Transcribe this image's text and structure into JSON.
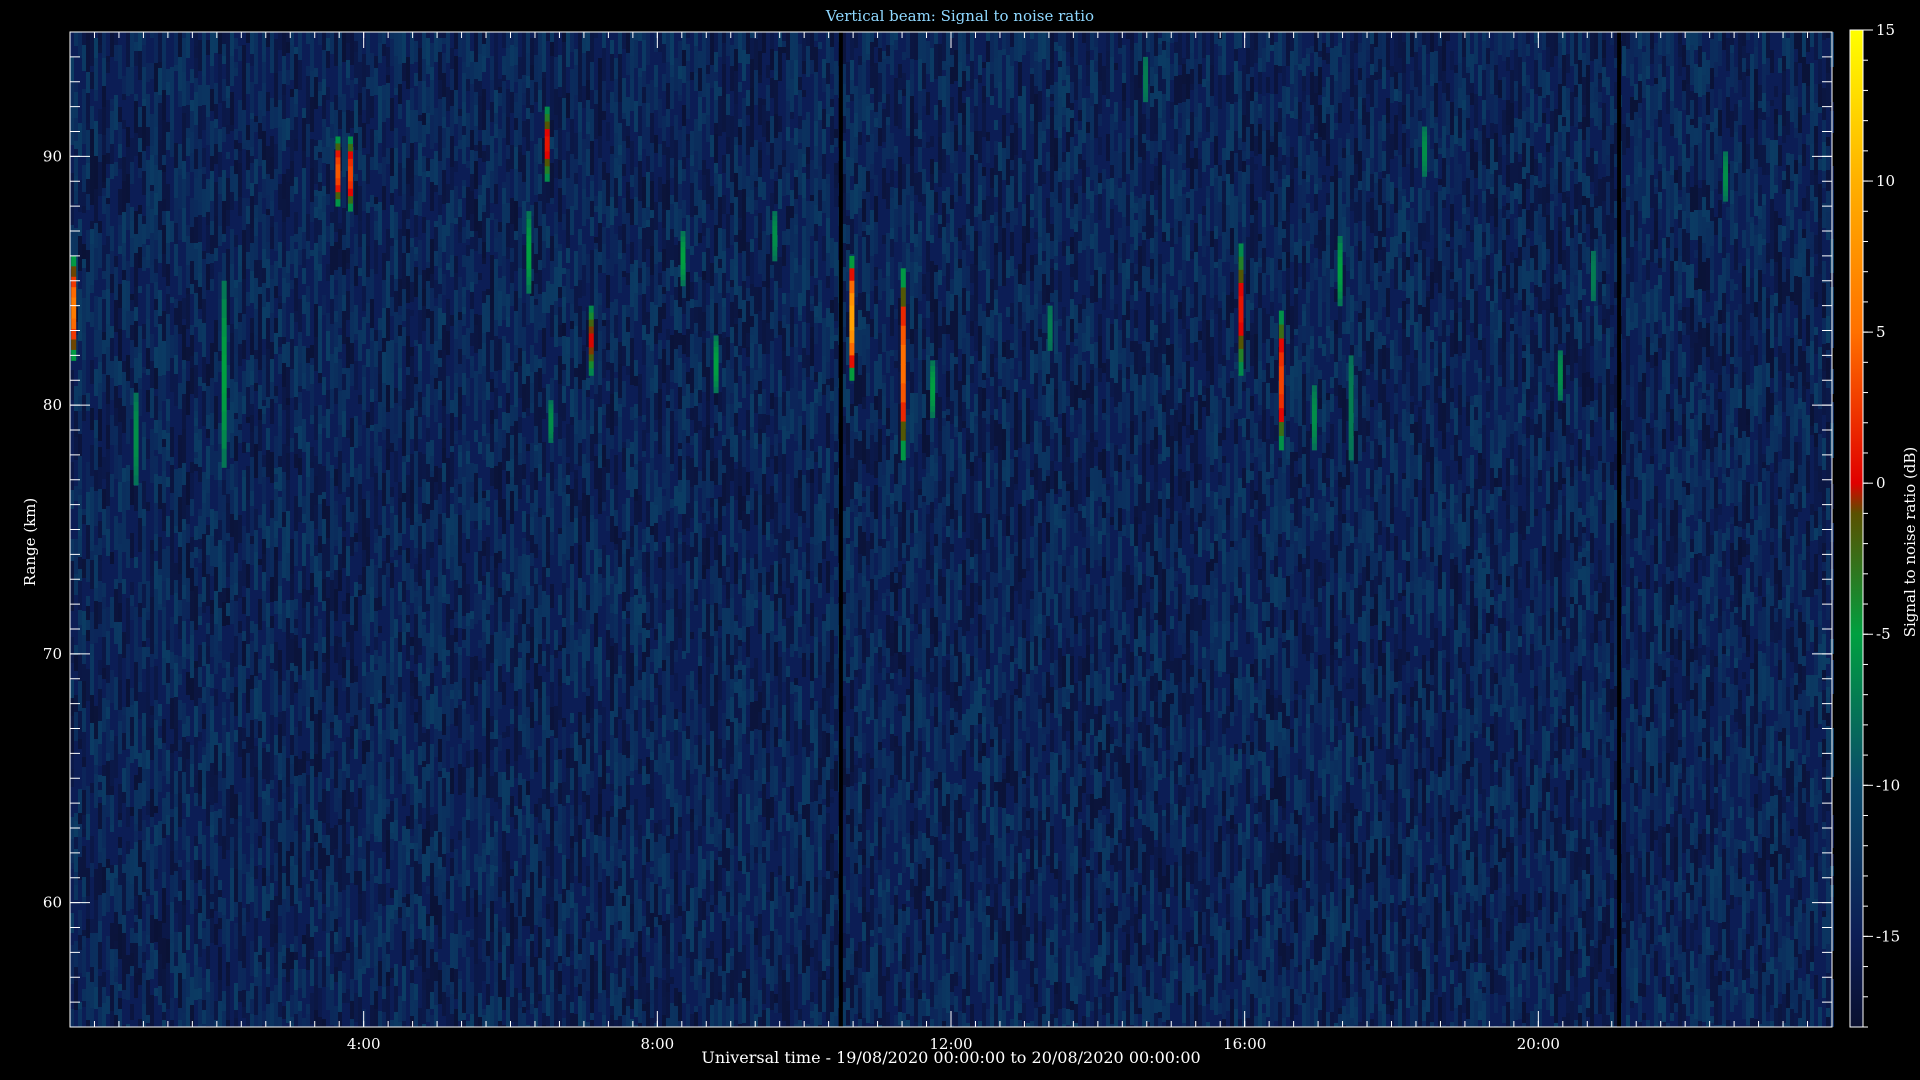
{
  "chart_data": {
    "type": "heatmap",
    "title": "Vertical beam: Signal to noise ratio",
    "xlabel": "Universal time - 19/08/2020 00:00:00 to 20/08/2020 00:00:00",
    "ylabel": "Range (km)",
    "colorbar_label": "Signal to noise ratio (dB)",
    "xlim_hours": [
      0,
      24
    ],
    "ylim_km": [
      55,
      95
    ],
    "x_ticks": [
      {
        "hour": 4,
        "label": "4:00"
      },
      {
        "hour": 8,
        "label": "8:00"
      },
      {
        "hour": 12,
        "label": "12:00"
      },
      {
        "hour": 16,
        "label": "16:00"
      },
      {
        "hour": 20,
        "label": "20:00"
      }
    ],
    "y_ticks": [
      {
        "km": 60,
        "label": "60"
      },
      {
        "km": 70,
        "label": "70"
      },
      {
        "km": 80,
        "label": "80"
      },
      {
        "km": 90,
        "label": "90"
      }
    ],
    "colorbar_range_db": [
      -18,
      15
    ],
    "colorbar_ticks": [
      {
        "db": 15,
        "label": "15"
      },
      {
        "db": 10,
        "label": "10"
      },
      {
        "db": 5,
        "label": "5"
      },
      {
        "db": 0,
        "label": "0"
      },
      {
        "db": -5,
        "label": "-5"
      },
      {
        "db": -10,
        "label": "-10"
      },
      {
        "db": -15,
        "label": "-15"
      }
    ],
    "colormap": [
      {
        "db": -18,
        "color": "#0a1030"
      },
      {
        "db": -15,
        "color": "#0c1d55"
      },
      {
        "db": -10,
        "color": "#0a4a6a"
      },
      {
        "db": -5,
        "color": "#00a040"
      },
      {
        "db": -1,
        "color": "#5a5000"
      },
      {
        "db": 0,
        "color": "#e00000"
      },
      {
        "db": 5,
        "color": "#ff7000"
      },
      {
        "db": 10,
        "color": "#ffb000"
      },
      {
        "db": 15,
        "color": "#ffff00"
      }
    ],
    "background_level_db": -15,
    "data_gaps_hours": [
      10.5,
      21.1
    ],
    "echoes": [
      {
        "hour": 0.05,
        "range_km": [
          81.8,
          86.0
        ],
        "peak_db": 6
      },
      {
        "hour": 0.9,
        "range_km": [
          76.8,
          80.5
        ],
        "peak_db": -6
      },
      {
        "hour": 2.1,
        "range_km": [
          77.5,
          85.0
        ],
        "peak_db": -5
      },
      {
        "hour": 3.65,
        "range_km": [
          88.0,
          90.8
        ],
        "peak_db": 4
      },
      {
        "hour": 3.82,
        "range_km": [
          87.8,
          90.8
        ],
        "peak_db": 3
      },
      {
        "hour": 6.25,
        "range_km": [
          84.5,
          87.8
        ],
        "peak_db": -5
      },
      {
        "hour": 6.5,
        "range_km": [
          89.0,
          92.0
        ],
        "peak_db": 1
      },
      {
        "hour": 6.55,
        "range_km": [
          78.5,
          80.2
        ],
        "peak_db": -6
      },
      {
        "hour": 7.1,
        "range_km": [
          81.2,
          84.0
        ],
        "peak_db": 0
      },
      {
        "hour": 8.35,
        "range_km": [
          84.8,
          87.0
        ],
        "peak_db": -5
      },
      {
        "hour": 8.8,
        "range_km": [
          80.5,
          82.8
        ],
        "peak_db": -5
      },
      {
        "hour": 9.6,
        "range_km": [
          85.8,
          87.8
        ],
        "peak_db": -6
      },
      {
        "hour": 10.65,
        "range_km": [
          81.0,
          86.0
        ],
        "peak_db": 9
      },
      {
        "hour": 11.35,
        "range_km": [
          77.8,
          85.5
        ],
        "peak_db": 5
      },
      {
        "hour": 11.75,
        "range_km": [
          79.5,
          81.8
        ],
        "peak_db": -5
      },
      {
        "hour": 13.35,
        "range_km": [
          82.2,
          84.0
        ],
        "peak_db": -7
      },
      {
        "hour": 14.65,
        "range_km": [
          92.2,
          94.0
        ],
        "peak_db": -7
      },
      {
        "hour": 15.95,
        "range_km": [
          81.2,
          86.5
        ],
        "peak_db": 1
      },
      {
        "hour": 16.5,
        "range_km": [
          78.2,
          83.8
        ],
        "peak_db": 3
      },
      {
        "hour": 16.95,
        "range_km": [
          78.2,
          80.8
        ],
        "peak_db": -6
      },
      {
        "hour": 17.3,
        "range_km": [
          84.0,
          86.8
        ],
        "peak_db": -5
      },
      {
        "hour": 17.45,
        "range_km": [
          77.8,
          82.0
        ],
        "peak_db": -7
      },
      {
        "hour": 18.45,
        "range_km": [
          89.2,
          91.2
        ],
        "peak_db": -6
      },
      {
        "hour": 20.3,
        "range_km": [
          80.2,
          82.2
        ],
        "peak_db": -6
      },
      {
        "hour": 20.75,
        "range_km": [
          84.2,
          86.2
        ],
        "peak_db": -7
      },
      {
        "hour": 22.55,
        "range_km": [
          88.2,
          90.2
        ],
        "peak_db": -6
      }
    ]
  }
}
